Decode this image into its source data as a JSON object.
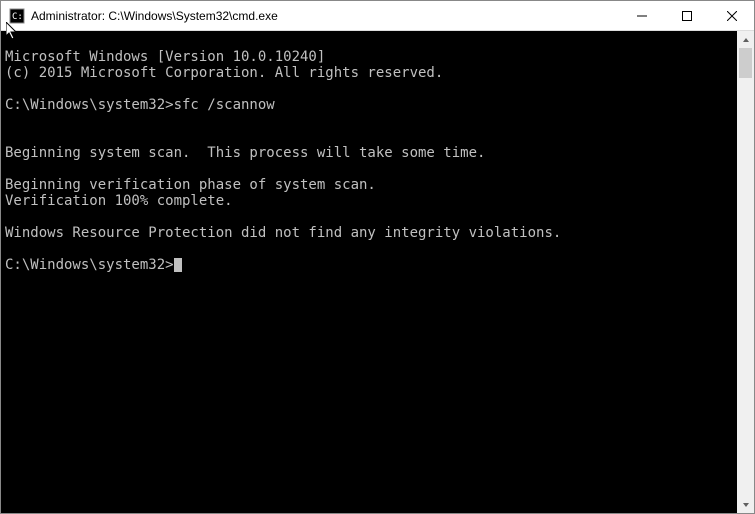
{
  "window": {
    "title": "Administrator: C:\\Windows\\System32\\cmd.exe"
  },
  "console": {
    "line1": "Microsoft Windows [Version 10.0.10240]",
    "line2": "(c) 2015 Microsoft Corporation. All rights reserved.",
    "blank1": "",
    "prompt1": "C:\\Windows\\system32>",
    "command1": "sfc /scannow",
    "blank2": "",
    "line3": "Beginning system scan.  This process will take some time.",
    "blank3": "",
    "line4": "Beginning verification phase of system scan.",
    "line5": "Verification 100% complete.",
    "blank4": "",
    "line6": "Windows Resource Protection did not find any integrity violations.",
    "blank5": "",
    "prompt2": "C:\\Windows\\system32>"
  }
}
